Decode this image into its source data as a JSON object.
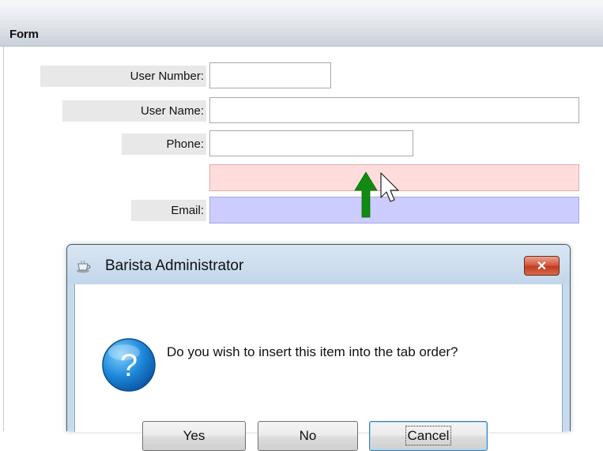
{
  "form": {
    "title": "Form",
    "fields": {
      "user_number": {
        "label": "User Number:",
        "value": ""
      },
      "user_name": {
        "label": "User Name:",
        "value": ""
      },
      "phone": {
        "label": "Phone:",
        "value": ""
      },
      "inserted_item": {
        "value": ""
      },
      "email": {
        "label": "Email:",
        "value": ""
      }
    }
  },
  "dialog": {
    "title": "Barista Administrator",
    "close_label": "✕",
    "message": "Do you wish to insert this item into the tab order?",
    "buttons": {
      "yes": "Yes",
      "no": "No",
      "cancel": "Cancel"
    }
  },
  "icons": {
    "dialog_app": "coffee-cup-icon",
    "question": "question-icon",
    "arrow": "up-arrow-icon",
    "cursor": "mouse-pointer-icon"
  },
  "colors": {
    "inserted_field_bg": "#ffdddd",
    "email_field_bg": "#ccccff",
    "arrow": "#118a11",
    "close_button": "#c94a2e"
  }
}
